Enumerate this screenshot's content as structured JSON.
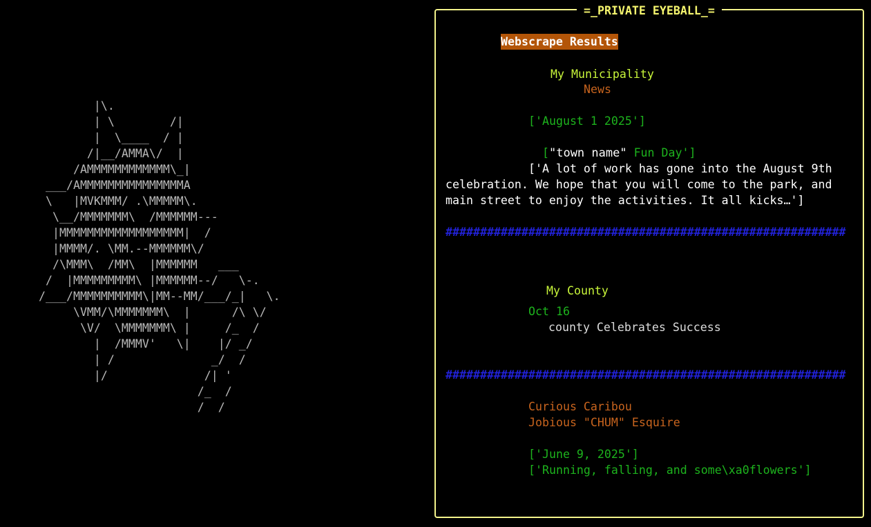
{
  "ascii_art": {
    "lines": [
      "        |\\.",
      "        | \\        /|",
      "        |  \\____  / |",
      "       /|__/AMMA\\/  |",
      "     /AMMMMMMMMMMMM\\_|",
      " ___/AMMMMMMMMMMMMMMMA",
      " \\   |MVKMMM/ .\\MMMMM\\.",
      "  \\__/MMMMMMM\\  /MMMMMM---",
      "  |MMMMMMMMMMMMMMMMMM|  /",
      "  |MMMM/. \\MM.--MMMMMM\\/",
      "  /\\MMM\\  /MM\\  |MMMMMM   ___",
      " /  |MMMMMMMMM\\ |MMMMMM--/   \\-.",
      "/___/MMMMMMMMMM\\|MM--MM/___/_|   \\.",
      "     \\VMM/\\MMMMMMM\\  |      /\\ \\/",
      "      \\V/  \\MMMMMMM\\ |     /_  /",
      "        |  /MMMV'   \\|    |/ _/",
      "        | /              _/  /",
      "        |/              /| '",
      "                       /_  /",
      "                       /  /"
    ]
  },
  "panel": {
    "title": "=_PRIVATE EYEBALL_=",
    "results_label": "Webscrape Results",
    "municipality": {
      "heading": "My Municipality",
      "subheading": "News",
      "date": "['August 1 2025']",
      "headline_open": "[",
      "headline_town": "\"town name\"",
      "headline_rest": " Fun Day']",
      "body": "['A lot of work has gone into the August 9th celebration. We hope that you will come to the park, and main street to enjoy the activities. It all kicks…']"
    },
    "separator": "##########################################################",
    "county": {
      "heading": "My County",
      "date": "Oct 16",
      "headline": "county Celebrates Success"
    },
    "caribou": {
      "source": "Curious Caribou",
      "author": "Jobious \"CHUM\" Esquire",
      "date": "['June 9, 2025']",
      "headline": "['Running, falling, and some\\xa0flowers']"
    }
  },
  "colors": {
    "background": "#000000",
    "panel_border": "#f4f48c",
    "title": "#f5f56e",
    "results_label_bg": "#b35508",
    "heading": "#c8f53a",
    "orange": "#c8641e",
    "green": "#1db31d",
    "separator": "#2121d6"
  }
}
